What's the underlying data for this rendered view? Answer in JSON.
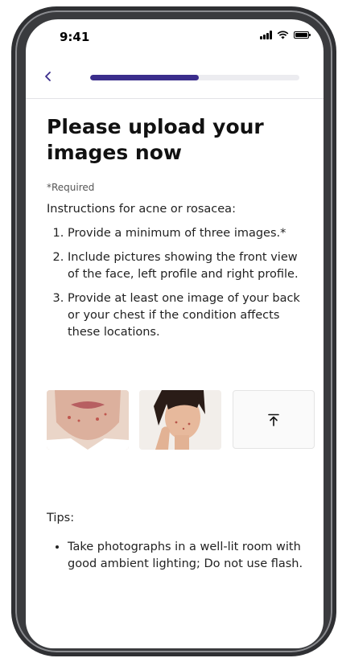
{
  "status_bar": {
    "time": "9:41",
    "icons": [
      "signal-icon",
      "wifi-icon",
      "battery-icon"
    ]
  },
  "nav": {
    "back_icon": "chevron-left-icon",
    "progress": 0.52
  },
  "page": {
    "title": "Please upload your images now",
    "required_note": "*Required",
    "intro": "Instructions for acne or rosacea:",
    "steps": [
      "Provide a minimum of three images.*",
      "Include pictures showing the front view of the face, left profile and right profile.",
      "Provide at least one image of your back or your chest if the condition affects these locations."
    ]
  },
  "uploads": {
    "thumbnails": [
      "photo-chin-closeup",
      "photo-face-profile"
    ],
    "upload_icon": "upload-icon"
  },
  "tips": {
    "label": "Tips:",
    "items": [
      "Take photographs in a well-lit room with good ambient lighting; Do not use flash."
    ]
  },
  "colors": {
    "accent": "#3b2d8c",
    "track": "#ececf0",
    "frame": "#2f3033"
  }
}
